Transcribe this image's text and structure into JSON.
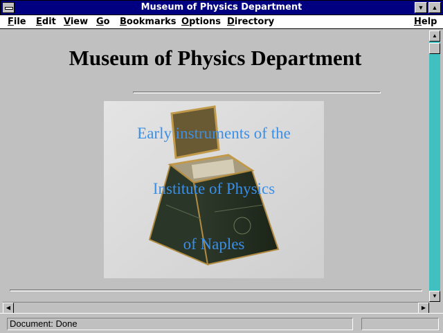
{
  "window": {
    "title": "Museum of Physics Department"
  },
  "menu": [
    {
      "label": "File",
      "key": "F"
    },
    {
      "label": "Edit",
      "key": "E"
    },
    {
      "label": "View",
      "key": "V"
    },
    {
      "label": "Go",
      "key": "G"
    },
    {
      "label": "Bookmarks",
      "key": "B"
    },
    {
      "label": "Options",
      "key": "O"
    },
    {
      "label": "Directory",
      "key": "D"
    },
    {
      "label": "Help",
      "key": "H"
    }
  ],
  "page": {
    "heading": "Museum of Physics Department",
    "hero_lines": [
      "Early instruments of the",
      "Institute of Physics",
      "of Naples"
    ]
  },
  "status": {
    "text": "Document: Done"
  },
  "colors": {
    "titlebar": "#000080",
    "scroll_track": "#40c0c0",
    "hero_text": "#3a8fe8"
  },
  "icons": [
    "system-menu-icon",
    "minimize-icon",
    "maximize-icon",
    "scroll-up-icon",
    "scroll-down-icon",
    "scroll-left-icon",
    "scroll-right-icon"
  ]
}
